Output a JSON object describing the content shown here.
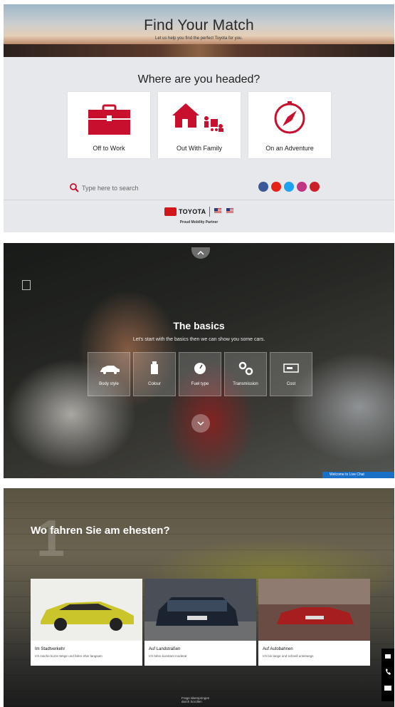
{
  "toyota": {
    "hero_title": "Find Your Match",
    "hero_subtitle": "Let us help you find the perfect Toyota for you.",
    "question": "Where are you headed?",
    "cards": [
      {
        "label": "Off to Work",
        "icon": "briefcase-icon"
      },
      {
        "label": "Out With Family",
        "icon": "house-family-icon"
      },
      {
        "label": "On an Adventure",
        "icon": "compass-icon"
      }
    ],
    "search_placeholder": "Type here to search",
    "social": [
      {
        "icon": "facebook-icon",
        "color": "#3b5998"
      },
      {
        "icon": "youtube-icon",
        "color": "#e62117"
      },
      {
        "icon": "twitter-icon",
        "color": "#1da1f2"
      },
      {
        "icon": "instagram-icon",
        "color": "#c13584"
      },
      {
        "icon": "pinterest-icon",
        "color": "#cb2027"
      }
    ],
    "brand": "TOYOTA",
    "partner_text": "Proud Mobility Partner",
    "accent_color": "#c8102e"
  },
  "basics": {
    "title": "The basics",
    "subtitle": "Let's start with the basics then we can show you some cars.",
    "options": [
      {
        "label": "Body style",
        "icon": "car-icon"
      },
      {
        "label": "Colour",
        "icon": "paint-can-icon"
      },
      {
        "label": "Fuel type",
        "icon": "fuel-gauge-icon"
      },
      {
        "label": "Transmission",
        "icon": "gears-icon"
      },
      {
        "label": "Cost",
        "icon": "price-tag-icon"
      }
    ],
    "chat_label": "Welcome to Live Chat"
  },
  "audi": {
    "step_number": "1",
    "title": "Wo fahren Sie am ehesten?",
    "cards": [
      {
        "title": "Im Stadtverkehr",
        "desc": "Ich mache kurze Wege und fahre eher langsam"
      },
      {
        "title": "Auf Landstraßen",
        "desc": "Ich fahre konstant moderat"
      },
      {
        "title": "Auf Autobahnen",
        "desc": "Ich bin lange und schnell unterwegs"
      }
    ],
    "skip_line1": "Frage überspringen",
    "skip_line2": "durch Scrollen"
  }
}
